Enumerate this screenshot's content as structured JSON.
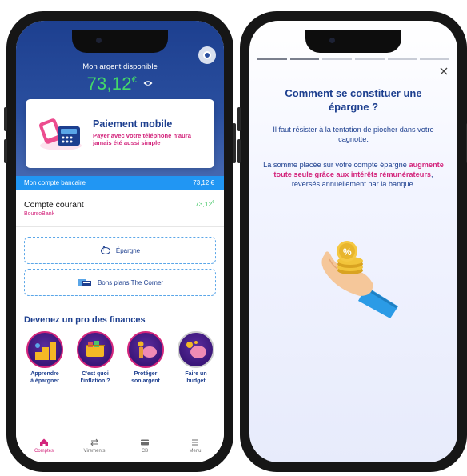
{
  "left_phone": {
    "balance_label": "Mon argent disponible",
    "balance_value": "73,12",
    "balance_currency": "€",
    "promo": {
      "title": "Paiement mobile",
      "text": "Payer avec votre téléphone n'aura jamais été aussi simple"
    },
    "account_bar": {
      "label": "Mon compte bancaire",
      "amount": "73,12 €"
    },
    "account": {
      "name": "Compte courant",
      "bank": "BoursoBank",
      "amount": "73,12",
      "currency": "€"
    },
    "buttons": {
      "epargne": "Épargne",
      "corner": "Bons plans The Corner"
    },
    "section_title": "Devenez un pro des finances",
    "tiles": [
      {
        "line1": "Apprendre",
        "line2": "à épargner"
      },
      {
        "line1": "C'est quoi",
        "line2": "l'inflation ?"
      },
      {
        "line1": "Protéger",
        "line2": "son argent"
      },
      {
        "line1": "Faire un",
        "line2": "budget"
      }
    ],
    "tabs": [
      {
        "label": "Comptes",
        "icon": "home-icon",
        "active": true
      },
      {
        "label": "Virements",
        "icon": "transfer-icon",
        "active": false
      },
      {
        "label": "CB",
        "icon": "card-icon",
        "active": false
      },
      {
        "label": "Menu",
        "icon": "menu-icon",
        "active": false
      }
    ]
  },
  "right_phone": {
    "title": "Comment se constituer une épargne ?",
    "paragraph1": "Il faut résister à la tentation de piocher dans votre cagnotte.",
    "paragraph2_start": "La somme placée sur votre compte épargne ",
    "paragraph2_highlight": "augmente toute seule grâce aux intérêts rémunérateurs",
    "paragraph2_end": ", reversés annuellement par la banque.",
    "progress_segments": 6,
    "progress_done": 2
  },
  "colors": {
    "navy": "#1d3f8f",
    "pink": "#d3257c",
    "green": "#43d86a",
    "blue_bar": "#2196f3"
  }
}
